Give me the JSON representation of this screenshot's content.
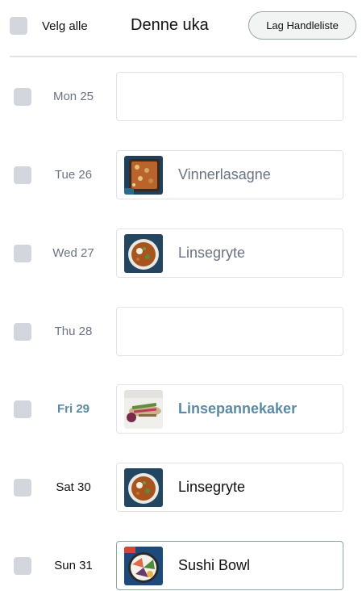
{
  "header": {
    "select_all_label": "Velg alle",
    "title": "Denne uka",
    "shopping_list_button": "Lag Handleliste"
  },
  "days": [
    {
      "day": "Mon 25",
      "dish": "",
      "style": "muted",
      "image": "none"
    },
    {
      "day": "Tue 26",
      "dish": "Vinnerlasagne",
      "style": "muted",
      "image": "lasagna"
    },
    {
      "day": "Wed 27",
      "dish": "Linsegryte",
      "style": "muted",
      "image": "stew"
    },
    {
      "day": "Thu 28",
      "dish": "",
      "style": "muted",
      "image": "none"
    },
    {
      "day": "Fri 29",
      "dish": "Linsepannekaker",
      "style": "accent",
      "image": "pancakes"
    },
    {
      "day": "Sat 30",
      "dish": "Linsegryte",
      "style": "dark",
      "image": "stew"
    },
    {
      "day": "Sun 31",
      "dish": "Sushi Bowl",
      "style": "dark",
      "image": "sushi"
    }
  ],
  "colors": {
    "accent": "#5a8aa6",
    "muted_text": "#6b7280",
    "checkbox": "#d3d6dc",
    "selected_border": "#8fa8a4"
  }
}
